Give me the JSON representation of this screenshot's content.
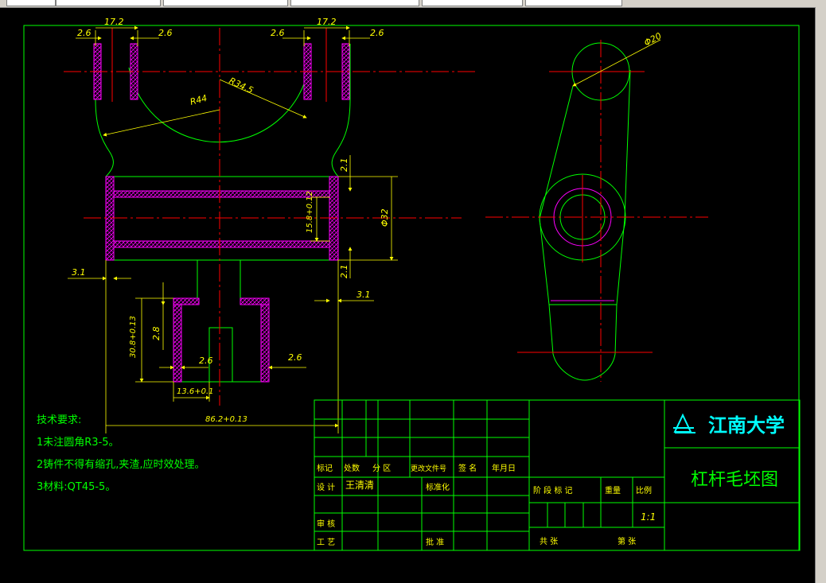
{
  "dims": {
    "top_width_left": "17.2",
    "top_width_right": "17.2",
    "wall_left_a": "2.6",
    "wall_left_b": "2.6",
    "wall_right_a": "2.6",
    "wall_right_b": "2.6",
    "radius_inner": "R34.5",
    "radius_outer": "R44",
    "dia_20": "Φ20",
    "dia_32": "Φ32",
    "fork_gap": "2.1",
    "fork_gap_low": "2.1",
    "hole_dia": "15.8+0.12",
    "side_left": "3.1",
    "side_right": "3.1",
    "boss_height": "30.8+0.13",
    "boss_wall": "2.8",
    "boss_inner": "2.6",
    "boss_right": "2.6",
    "boss_width": "13.6+0.1",
    "overall": "86.2+0.13"
  },
  "notes": {
    "heading": "技术要求:",
    "line1": "1未注圆角R3-5。",
    "line2": "2铸件不得有缩孔,夹渣,应时效处理。",
    "line3": "3材料:QT45-5。"
  },
  "title_block": {
    "headers": [
      "标记",
      "处数",
      "分 区",
      "更改文件号",
      "签 名",
      "年月日"
    ],
    "design_label": "设 计",
    "designer": "王清清",
    "std_label": "标准化",
    "check_label": "审 核",
    "process_label": "工 艺",
    "approve_label": "批 准",
    "stage_label": "阶 段 标 记",
    "weight_label": "重量",
    "scale_label": "比例",
    "scale_value": "1:1",
    "sheets_total": "共    张",
    "sheet_no": "第    张",
    "university": "江南大学",
    "drawing_title": "杠杆毛坯图"
  },
  "colors": {
    "outline": "#00ff00",
    "centerline": "#ff0000",
    "dimension": "#ffff00",
    "hatch": "#ff00ff",
    "title_text": "#00ffff"
  }
}
